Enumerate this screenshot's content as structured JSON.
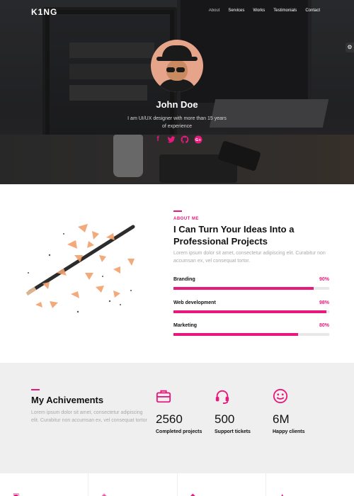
{
  "colors": {
    "accent": "#e8197c",
    "heading": "#111111",
    "muted": "#aaaaaa"
  },
  "nav": {
    "logo": "K1NG",
    "links": [
      "About",
      "Services",
      "Works",
      "Testimonials",
      "Contact"
    ],
    "active": "About"
  },
  "hero": {
    "name": "John Doe",
    "bio": "I am UI/UX designer with more than 15 years of experience",
    "socials": [
      "facebook-icon",
      "twitter-icon",
      "github-icon",
      "google-plus-icon"
    ]
  },
  "about": {
    "kicker": "ABOUT ME",
    "title": "I Can Turn Your Ideas Into a Professional Projects",
    "text": "Lorem ipsum dolor sit amet, consectetur adipiscing elit. Curabitur non accumsan ex, vel consequat tortor.",
    "skills": [
      {
        "name": "Branding",
        "percent": 90,
        "label": "90%"
      },
      {
        "name": "Web development",
        "percent": 98,
        "label": "98%"
      },
      {
        "name": "Marketing",
        "percent": 80,
        "label": "80%"
      }
    ]
  },
  "achievements": {
    "title": "My Achivements",
    "text": "Lorem ipsum dolor sit amet, consectetur adipiscing elit. Curabitur non accumsan ex, vel consequat tortor",
    "stats": [
      {
        "icon": "briefcase-icon",
        "number": "2560",
        "label": "Completed projects"
      },
      {
        "icon": "headset-icon",
        "number": "500",
        "label": "Support tickets"
      },
      {
        "icon": "smiley-icon",
        "number": "6M",
        "label": "Happy clients"
      }
    ]
  }
}
